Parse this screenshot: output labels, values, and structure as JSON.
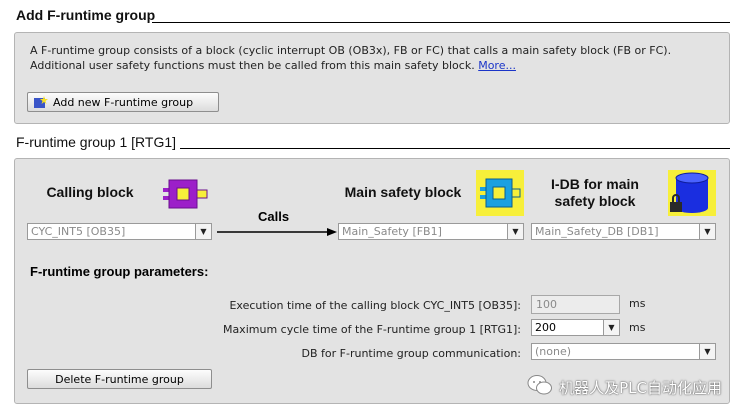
{
  "add_section": {
    "title": "Add F-runtime group",
    "description": "A F-runtime group consists of a block (cyclic interrupt OB (OB3x), FB or FC) that calls a main safety block (FB or FC). Additional user safety functions must then be called from this main safety block.",
    "more_link": "More...",
    "add_button": "Add new F-runtime group"
  },
  "group_section": {
    "title": "F-runtime group 1 [RTG1]",
    "calling_block": {
      "label": "Calling block",
      "value": "CYC_INT5 [OB35]"
    },
    "calls_label": "Calls",
    "main_safety_block": {
      "label": "Main safety block",
      "value": "Main_Safety [FB1]"
    },
    "idb": {
      "label": "I-DB for main safety block",
      "value": "Main_Safety_DB [DB1]"
    },
    "params_heading": "F-runtime group parameters:",
    "params": {
      "exec_time_label": "Execution time of the calling block CYC_INT5 [OB35]:",
      "exec_time_value": "100",
      "exec_time_unit": "ms",
      "max_cycle_label": "Maximum cycle time of the F-runtime group 1 [RTG1]:",
      "max_cycle_value": "200",
      "max_cycle_unit": "ms",
      "db_comm_label": "DB for F-runtime group communication:",
      "db_comm_value": "(none)"
    },
    "delete_button": "Delete F-runtime group"
  },
  "watermark": "机器人及PLC自动化应用",
  "colors": {
    "panel_bg": "#e3e3e3",
    "fb_icon": "#f7ef3a",
    "ob_icon": "#9c1fc9",
    "db_icon": "#1a2ee0",
    "link": "#1a34c8"
  }
}
